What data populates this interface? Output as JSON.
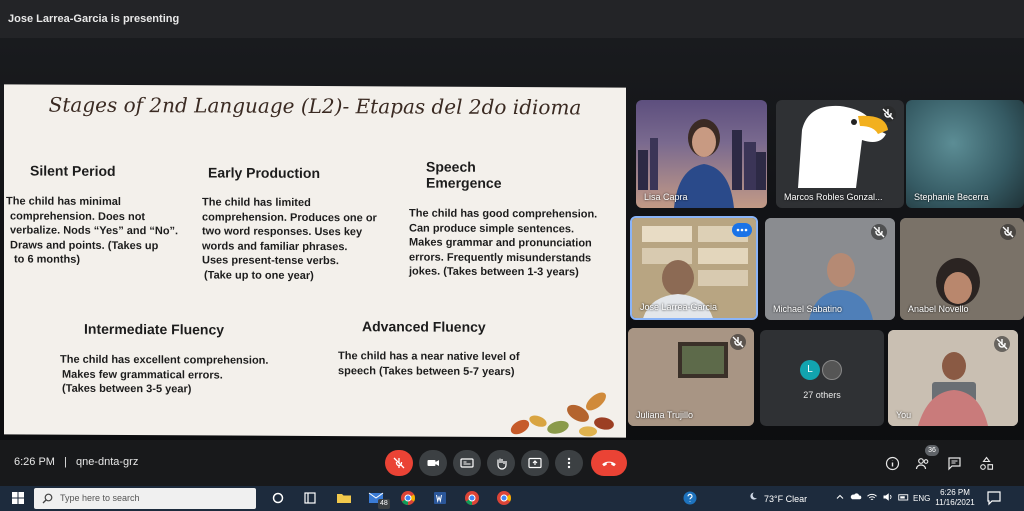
{
  "header": {
    "presenter_text": "Jose Larrea-Garcia is presenting"
  },
  "slide": {
    "title": "Stages of 2nd Language (L2)- Etapas del 2do idioma",
    "sections": [
      {
        "heading": "Silent Period",
        "lines": [
          "The child has minimal",
          "comprehension.  Does not",
          "verbalize. Nods “Yes” and “No”.",
          "Draws and points.  (Takes up",
          "to 6 months)"
        ]
      },
      {
        "heading": "Early Production",
        "lines": [
          "The child has limited",
          "comprehension. Produces one or",
          "two word responses. Uses key",
          "words and familiar phrases.",
          "Uses present-tense verbs.",
          "(Take up to one year)"
        ]
      },
      {
        "heading": "Speech Emergence",
        "lines": [
          "The child has good comprehension.",
          "Can produce simple sentences.",
          "Makes grammar and pronunciation",
          "errors. Frequently misunderstands",
          "jokes. (Takes between 1-3 years)"
        ]
      },
      {
        "heading": "Intermediate Fluency",
        "lines": [
          "The child has excellent comprehension.",
          "Makes few grammatical errors.",
          "(Takes between 3-5 year)"
        ]
      },
      {
        "heading": "Advanced Fluency",
        "lines": [
          "The child has a near native level of",
          "speech (Takes between 5-7 years)"
        ]
      }
    ]
  },
  "participants": [
    {
      "name": "Lisa Capra",
      "muted": false
    },
    {
      "name": "Marcos Robles Gonzal...",
      "muted": true
    },
    {
      "name": "Stephanie Becerra",
      "muted": false
    },
    {
      "name": "Jose Larrea-Garcia",
      "muted": false
    },
    {
      "name": "Michael Sabatino",
      "muted": true
    },
    {
      "name": "Anabel Novello",
      "muted": true
    },
    {
      "name": "Juliana Trujillo",
      "muted": true
    },
    {
      "name": "27 others",
      "avatar_letter": "L",
      "muted": false
    },
    {
      "name": "You",
      "muted": true
    }
  ],
  "meeting": {
    "time": "6:26 PM",
    "separator": "|",
    "code": "qne-dnta-grz",
    "people_count": "36"
  },
  "taskbar": {
    "search_placeholder": "Type here to search",
    "mail_badge": "48",
    "weather": "73°F  Clear",
    "lang": "ENG",
    "time": "6:26 PM",
    "date": "11/16/2021"
  },
  "colors": {
    "end_call": "#ea4335",
    "mic_off": "#ea4335",
    "active_tile_border": "#8ab4f8"
  }
}
